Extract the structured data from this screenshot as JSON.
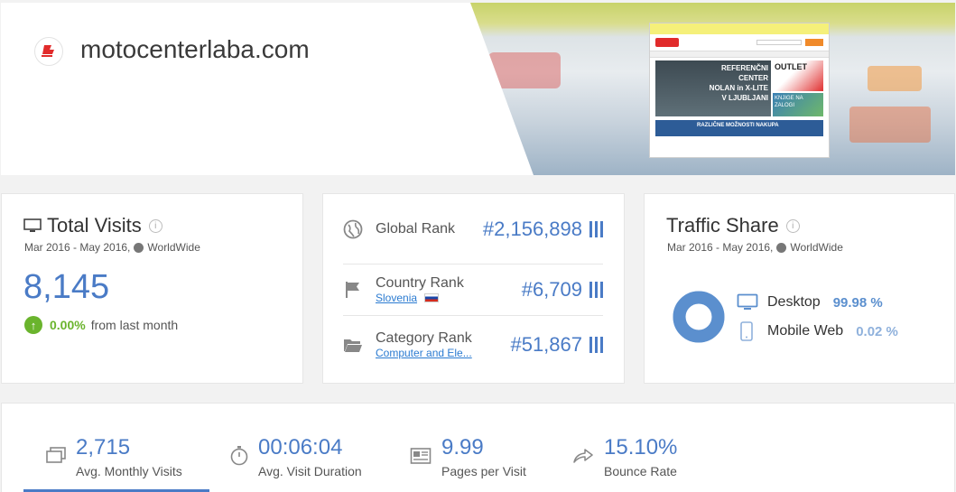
{
  "site": {
    "domain": "motocenterlaba.com",
    "favicon_color": "#e12b2b"
  },
  "preview": {
    "banner_lines": [
      "REFERENČNI CENTER",
      "NOLAN in X-LITE",
      "V LJUBLJANI"
    ],
    "outlet": "OUTLET",
    "knjige": "KNJIGE NA ZALOGI",
    "bottom_banner": "RAZLIČNE MOŽNOSTI NAKUPA"
  },
  "total_visits": {
    "title": "Total Visits",
    "date_range": "Mar 2016 - May 2016,",
    "region": "WorldWide",
    "value": "8,145",
    "change_pct": "0.00%",
    "change_text": "from last month",
    "change_color": "#6ab42d"
  },
  "ranks": {
    "global": {
      "label": "Global Rank",
      "value": "#2,156,898"
    },
    "country": {
      "label": "Country Rank",
      "link": "Slovenia",
      "value": "#6,709"
    },
    "category": {
      "label": "Category Rank",
      "link": "Computer and Ele...",
      "value": "#51,867"
    }
  },
  "traffic_share": {
    "title": "Traffic Share",
    "date_range": "Mar 2016 - May 2016,",
    "region": "WorldWide",
    "desktop_label": "Desktop",
    "desktop_pct": "99.98 %",
    "mobile_label": "Mobile Web",
    "mobile_pct": "0.02 %",
    "desktop_share": 0.9998,
    "accent": "#5b8fce"
  },
  "engagement": [
    {
      "value": "2,715",
      "label": "Avg. Monthly Visits",
      "icon": "monitor-stack-icon"
    },
    {
      "value": "00:06:04",
      "label": "Avg. Visit Duration",
      "icon": "stopwatch-icon"
    },
    {
      "value": "9.99",
      "label": "Pages per Visit",
      "icon": "newspaper-icon"
    },
    {
      "value": "15.10%",
      "label": "Bounce Rate",
      "icon": "share-arrow-icon"
    }
  ]
}
